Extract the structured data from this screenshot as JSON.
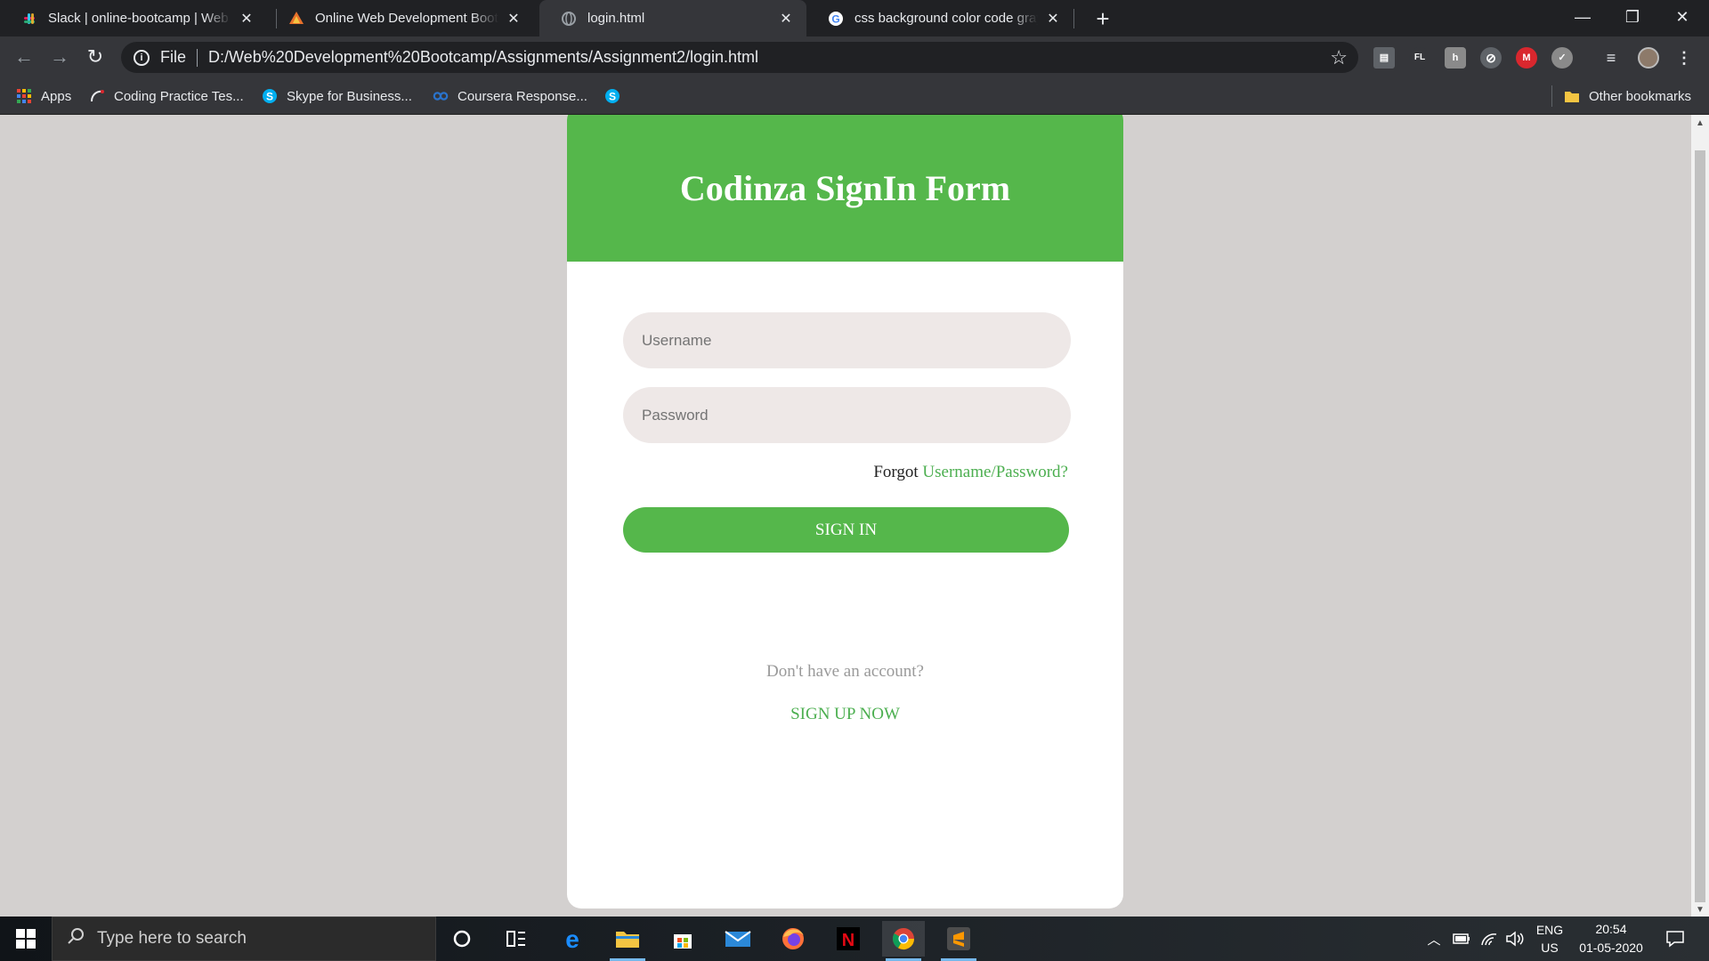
{
  "browser": {
    "tabs": [
      {
        "title": "Slack | online-bootcamp | Web D",
        "favicon": "slack-icon"
      },
      {
        "title": "Online Web Development Bootca",
        "favicon": "bootcamp-icon"
      },
      {
        "title": "login.html",
        "favicon": "globe-icon"
      },
      {
        "title": "css background color code gray",
        "favicon": "google-icon"
      }
    ],
    "close_glyph": "✕",
    "new_tab_glyph": "+",
    "omnibox": {
      "scheme_label": "File",
      "url": "D:/Web%20Development%20Bootcamp/Assignments/Assignment2/login.html"
    },
    "extensions": [
      {
        "name": "notes-extension-icon",
        "glyph": "▤",
        "color": "#5f6368"
      },
      {
        "name": "fl-extension-icon",
        "glyph": "FL",
        "color": "#35363a"
      },
      {
        "name": "honey-extension-icon",
        "glyph": "h",
        "color": "#8a8a8a"
      },
      {
        "name": "adblock-extension-icon",
        "glyph": "⊘",
        "color": "#5f6368"
      },
      {
        "name": "mega-extension-icon",
        "glyph": "M",
        "color": "#d9272e"
      },
      {
        "name": "grammar-extension-icon",
        "glyph": "✓",
        "color": "#8a8a8a"
      }
    ],
    "bookmarks": [
      {
        "label": "Apps",
        "icon": "apps-grid-icon"
      },
      {
        "label": "Coding Practice Tes...",
        "icon": "coding-icon"
      },
      {
        "label": "Skype for Business...",
        "icon": "skype-icon"
      },
      {
        "label": "Coursera Response...",
        "icon": "coursera-icon"
      },
      {
        "label": "",
        "icon": "skype-icon"
      }
    ],
    "other_bookmarks": "Other bookmarks"
  },
  "form": {
    "title": "Codinza SignIn Form",
    "username_placeholder": "Username",
    "password_placeholder": "Password",
    "forgot_prefix": "Forgot",
    "forgot_link": "Username/Password?",
    "signin_label": "SIGN IN",
    "no_account_text": "Don't have an account?",
    "signup_label": "SIGN UP NOW",
    "accent_color": "#55b74b"
  },
  "taskbar": {
    "search_placeholder": "Type here to search",
    "language_top": "ENG",
    "language_bottom": "US",
    "time": "20:54",
    "date": "01-05-2020"
  }
}
